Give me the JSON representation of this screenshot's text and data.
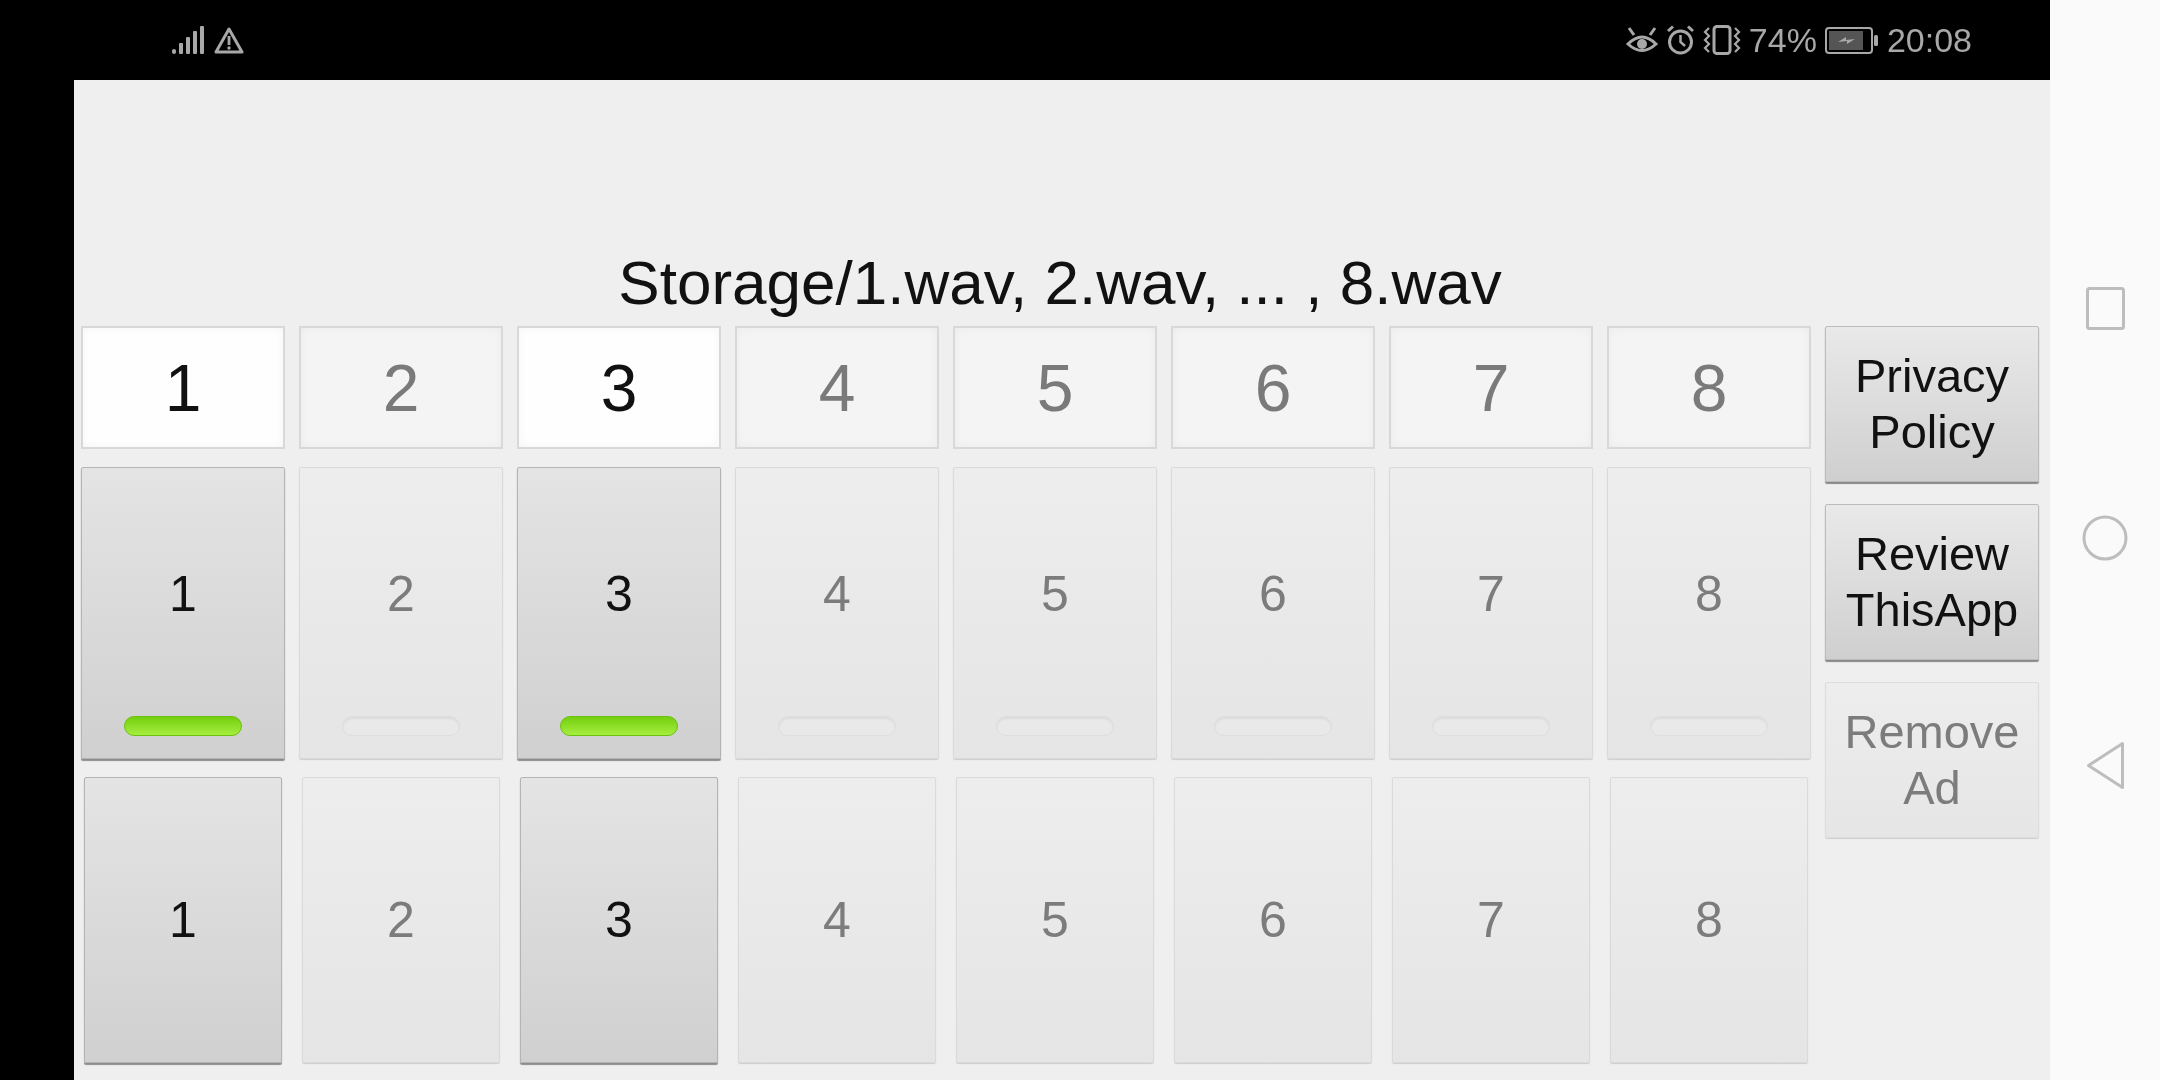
{
  "status_bar": {
    "battery": "74%",
    "time": "20:08"
  },
  "title": "Storage/1.wav, 2.wav, ... , 8.wav",
  "selector_row": [
    {
      "label": "1",
      "selected": true
    },
    {
      "label": "2",
      "selected": false
    },
    {
      "label": "3",
      "selected": true
    },
    {
      "label": "4",
      "selected": false
    },
    {
      "label": "5",
      "selected": false
    },
    {
      "label": "6",
      "selected": false
    },
    {
      "label": "7",
      "selected": false
    },
    {
      "label": "8",
      "selected": false
    }
  ],
  "indicator_pads": [
    {
      "label": "1",
      "on": true
    },
    {
      "label": "2",
      "on": false
    },
    {
      "label": "3",
      "on": true
    },
    {
      "label": "4",
      "on": false
    },
    {
      "label": "5",
      "on": false
    },
    {
      "label": "6",
      "on": false
    },
    {
      "label": "7",
      "on": false
    },
    {
      "label": "8",
      "on": false
    }
  ],
  "pads": [
    {
      "label": "1",
      "active": true
    },
    {
      "label": "2",
      "active": false
    },
    {
      "label": "3",
      "active": true
    },
    {
      "label": "4",
      "active": false
    },
    {
      "label": "5",
      "active": false
    },
    {
      "label": "6",
      "active": false
    },
    {
      "label": "7",
      "active": false
    },
    {
      "label": "8",
      "active": false
    }
  ],
  "side_buttons": [
    {
      "label": "Privacy Policy",
      "disabled": false
    },
    {
      "label": "Review ThisApp",
      "disabled": false
    },
    {
      "label": "Remove Ad",
      "disabled": true
    }
  ]
}
